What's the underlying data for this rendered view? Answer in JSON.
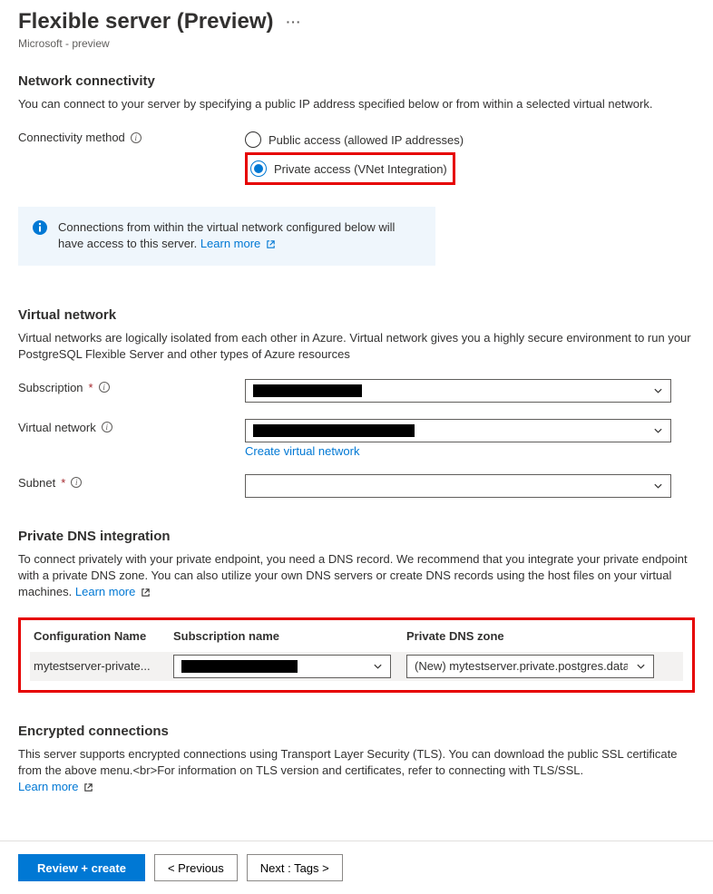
{
  "header": {
    "title": "Flexible server (Preview)",
    "subtitle": "Microsoft - preview"
  },
  "network": {
    "heading": "Network connectivity",
    "desc": "You can connect to your server by specifying a public IP address specified below or from within a selected virtual network.",
    "method_label": "Connectivity method",
    "opt_public": "Public access (allowed IP addresses)",
    "opt_private": "Private access (VNet Integration)"
  },
  "banner": {
    "text": "Connections from within the virtual network configured below will have access to this server.",
    "link": "Learn more"
  },
  "vnet": {
    "heading": "Virtual network",
    "desc": "Virtual networks are logically isolated from each other in Azure. Virtual network gives you a highly secure environment to run your PostgreSQL Flexible Server and other types of Azure resources",
    "subscription_label": "Subscription",
    "vnet_label": "Virtual network",
    "create_link": "Create virtual network",
    "subnet_label": "Subnet"
  },
  "dns": {
    "heading": "Private DNS integration",
    "desc": "To connect privately with your private endpoint, you need a DNS record. We recommend that you integrate your private endpoint with a private DNS zone. You can also utilize your own DNS servers or create DNS records using the host files on your virtual machines.",
    "learn": "Learn more",
    "col_cfg": "Configuration Name",
    "col_sub": "Subscription name",
    "col_dns": "Private DNS zone",
    "row_cfg": "mytestserver-private...",
    "row_dns": "(New) mytestserver.private.postgres.datab..."
  },
  "enc": {
    "heading": "Encrypted connections",
    "desc": "This server supports encrypted connections using Transport Layer Security (TLS). You can download the public SSL certificate from the above menu.<br>For information on TLS version and certificates, refer to connecting with TLS/SSL.",
    "learn": "Learn more"
  },
  "footer": {
    "review": "Review + create",
    "prev": "< Previous",
    "next": "Next : Tags >"
  }
}
